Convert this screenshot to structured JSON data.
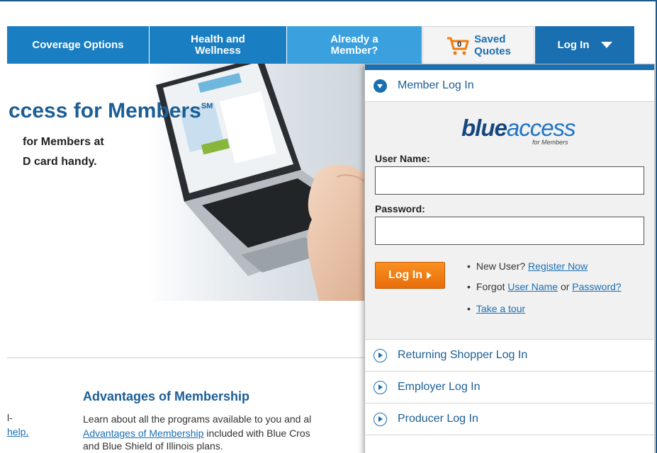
{
  "nav": {
    "coverage": "Coverage Options",
    "health_line1": "Health and",
    "health_line2": "Wellness",
    "member_line1": "Already a",
    "member_line2": "Member?",
    "saved_count": "0",
    "saved_line1": "Saved",
    "saved_line2": "Quotes",
    "login": "Log In"
  },
  "hero": {
    "title": "ccess for Members",
    "title_mark": "SM",
    "line1": "for Members at",
    "line2": "D card handy."
  },
  "content": {
    "left_dash": "l-",
    "left_help": "help",
    "left_help_suffix": ".",
    "adv_title": "Advantages of Membership",
    "adv_line1": "Learn about all the programs available to you and al",
    "adv_link": "Advantages of Membership",
    "adv_line2_rest": " included with Blue Cros",
    "adv_line3": "and Blue Shield of Illinois plans."
  },
  "panel": {
    "member_login": "Member Log In",
    "logo_blue": "blue",
    "logo_access": "access",
    "logo_sub": "for Members",
    "user_label": "User Name:",
    "user_value": "",
    "pass_label": "Password:",
    "pass_value": "",
    "login_button": "Log In",
    "new_user_prefix": "New User?",
    "register_link": "Register Now",
    "forgot_prefix": "Forgot",
    "username_link": "User Name",
    "or_text": "or",
    "password_link": "Password?",
    "tour_link": "Take a tour",
    "returning": "Returning Shopper Log In",
    "employer": "Employer Log In",
    "producer": "Producer Log In"
  },
  "colors": {
    "nav_blue": "#1a7ec2",
    "accent_orange": "#f8911f",
    "title_blue": "#1b5e96"
  }
}
